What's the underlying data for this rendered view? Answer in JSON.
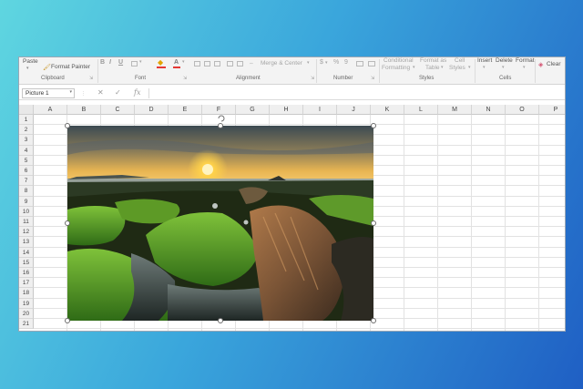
{
  "ribbon": {
    "clipboard": {
      "paste_label": "Paste",
      "format_painter_label": "Format Painter",
      "group_label": "Clipboard"
    },
    "font": {
      "bold_label": "B",
      "italic_label": "I",
      "underline_label": "U",
      "font_color_label": "A",
      "group_label": "Font"
    },
    "alignment": {
      "merge_center_label": "Merge & Center",
      "group_label": "Alignment"
    },
    "number": {
      "currency_label": "$",
      "percent_label": "%",
      "comma_label": "9",
      "group_label": "Number"
    },
    "styles": {
      "conditional_formatting_line1": "Conditional",
      "conditional_formatting_line2": "Formatting",
      "format_as_table_line1": "Format as",
      "format_as_table_line2": "Table",
      "cell_styles_line1": "Cell",
      "cell_styles_line2": "Styles",
      "group_label": "Styles"
    },
    "cells": {
      "insert_label": "Insert",
      "delete_label": "Delete",
      "format_label": "Format",
      "group_label": "Cells"
    },
    "editing": {
      "clear_label": "Clear"
    }
  },
  "formula_bar": {
    "name_box": "Picture 1",
    "cancel_label": "✕",
    "enter_label": "✓",
    "fx_label": "fx",
    "formula": ""
  },
  "grid": {
    "columns": [
      "A",
      "B",
      "C",
      "D",
      "E",
      "F",
      "G",
      "H",
      "I",
      "J",
      "K",
      "L",
      "M",
      "N",
      "O",
      "P"
    ],
    "rows": [
      "1",
      "2",
      "3",
      "4",
      "5",
      "6",
      "7",
      "8",
      "9",
      "10",
      "11",
      "12",
      "13",
      "14",
      "15",
      "16",
      "17",
      "18",
      "19",
      "20",
      "21"
    ]
  },
  "picture": {
    "name": "Picture 1",
    "subject": "sunset over mossy coastal rocks"
  },
  "colors": {
    "background_gradient_start": "#5fd6e0",
    "background_gradient_end": "#1f5fc4",
    "moss_green": "#4fa62a",
    "sun": "#ffd24a"
  }
}
